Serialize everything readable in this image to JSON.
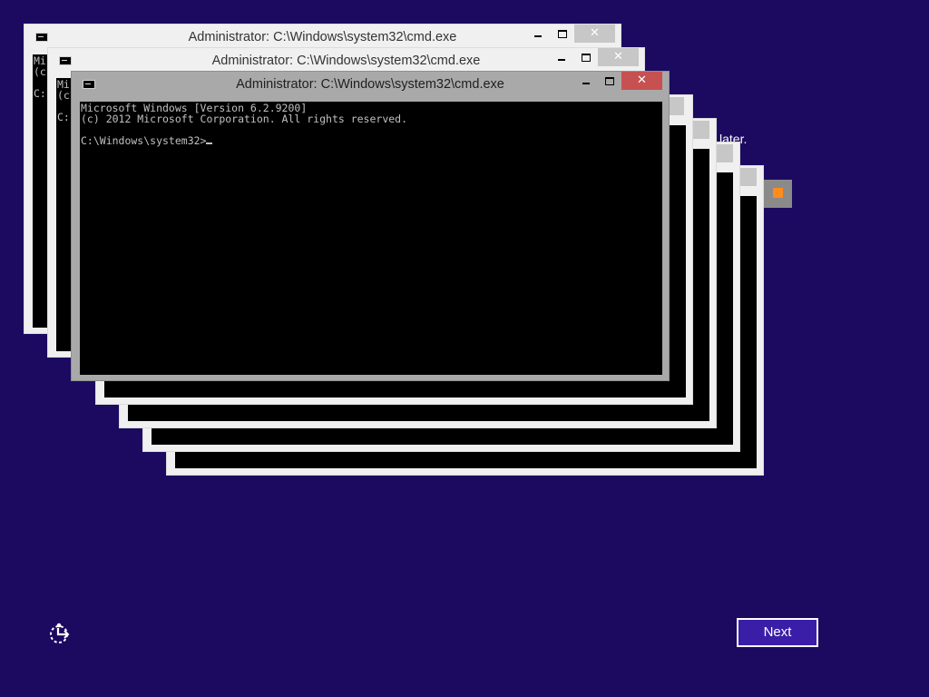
{
  "background_text": "later.",
  "windows": {
    "title": "Administrator: C:\\Windows\\system32\\cmd.exe",
    "close_glyph": "✕",
    "icon": "console-app-icon",
    "active": {
      "lines": [
        "Microsoft Windows [Version 6.2.9200]",
        "(c) 2012 Microsoft Corporation. All rights reserved.",
        "",
        "C:\\Windows\\system32>"
      ]
    },
    "back1_partial": [
      "Mi",
      "(c",
      "",
      "C:"
    ],
    "back2_partial": [
      "Mi",
      "(c",
      "",
      "C:"
    ]
  },
  "setup": {
    "next_label": "Next",
    "ease_of_access_icon": "ease-of-access-icon"
  },
  "colors": {
    "background": "#1b0a60",
    "active_close": "#c75050",
    "next_button": "#3a1ea8"
  }
}
